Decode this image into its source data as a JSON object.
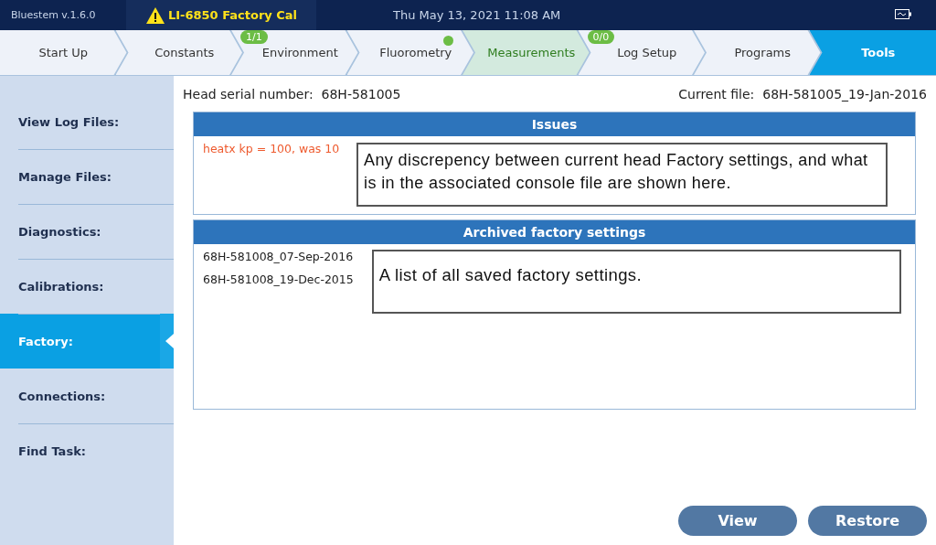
{
  "top_bar": {
    "version": "Bluestem v.1.6.0",
    "alert": {
      "text": "LI-6850 Factory Cal",
      "warning": true
    },
    "datetime": "Thu May 13, 2021 11:08 AM"
  },
  "tabs": [
    {
      "label": "Start Up",
      "selected": false,
      "highlighted": false
    },
    {
      "label": "Constants",
      "selected": false,
      "highlighted": false
    },
    {
      "label": "Environment",
      "selected": false,
      "highlighted": false,
      "badge": "1/1"
    },
    {
      "label": "Fluorometry",
      "selected": false,
      "highlighted": false,
      "dot": true
    },
    {
      "label": "Measurements",
      "selected": false,
      "highlighted": true
    },
    {
      "label": "Log Setup",
      "selected": false,
      "highlighted": false,
      "badge": "0/0"
    },
    {
      "label": "Programs",
      "selected": false,
      "highlighted": false
    },
    {
      "label": "Tools",
      "selected": true,
      "highlighted": false
    }
  ],
  "sidebar": {
    "items": [
      {
        "label": "View Log Files:",
        "selected": false
      },
      {
        "label": "Manage Files:",
        "selected": false
      },
      {
        "label": "Diagnostics:",
        "selected": false
      },
      {
        "label": "Calibrations:",
        "selected": false
      },
      {
        "label": "Factory:",
        "selected": true
      },
      {
        "label": "Connections:",
        "selected": false
      },
      {
        "label": "Find Task:",
        "selected": false
      }
    ]
  },
  "header": {
    "serial_label": "Head serial number:",
    "serial": "68H-581005",
    "file_label": "Current file:",
    "file": "68H-581005_19-Jan-2016"
  },
  "issues": {
    "title": "Issues",
    "items": [
      "heatx kp = 100, was 10"
    ],
    "note": "Any discrepency between current head Factory settings, and what is in the associated console file are shown here."
  },
  "archived": {
    "title": "Archived factory settings",
    "items": [
      "68H-581008_07-Sep-2016",
      "68H-581008_19-Dec-2015"
    ],
    "note": "A list of all saved factory settings."
  },
  "buttons": [
    "View",
    "Restore"
  ]
}
